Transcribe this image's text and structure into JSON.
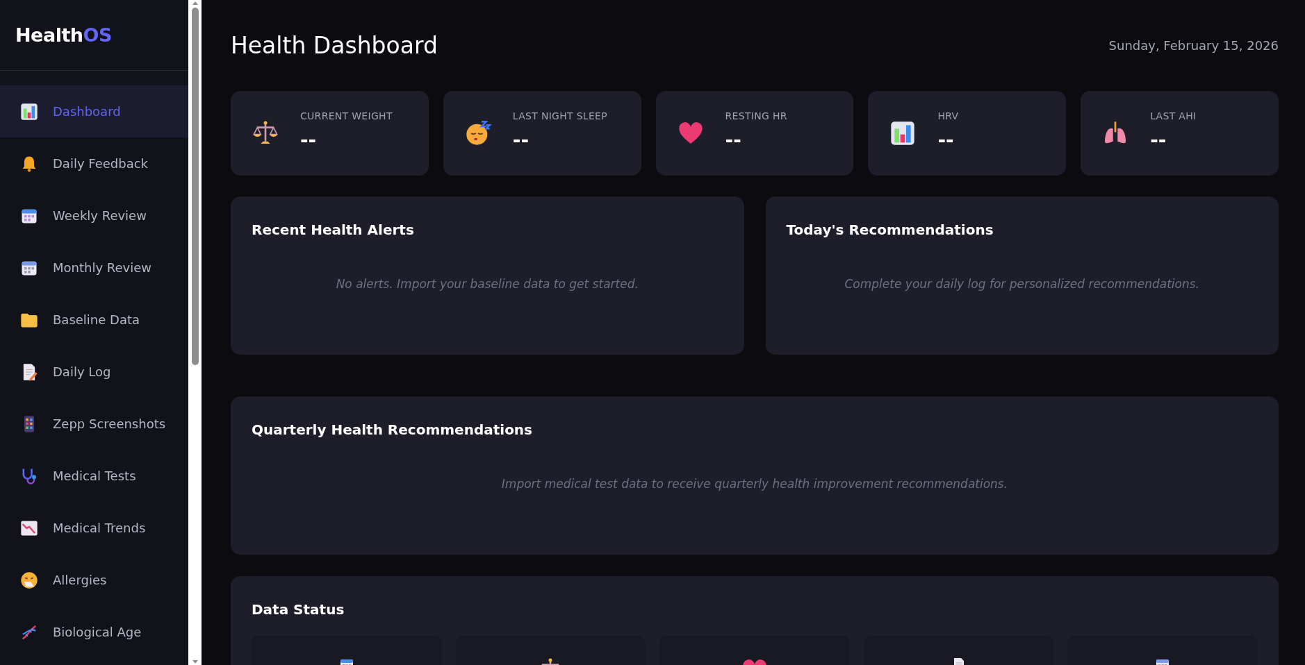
{
  "logo": {
    "prefix": "Health",
    "suffix": "OS"
  },
  "sidebar": {
    "items": [
      {
        "label": "Dashboard",
        "selected": true
      },
      {
        "label": "Daily Feedback",
        "selected": false
      },
      {
        "label": "Weekly Review",
        "selected": false
      },
      {
        "label": "Monthly Review",
        "selected": false
      },
      {
        "label": "Baseline Data",
        "selected": false
      },
      {
        "label": "Daily Log",
        "selected": false
      },
      {
        "label": "Zepp Screenshots",
        "selected": false
      },
      {
        "label": "Medical Tests",
        "selected": false
      },
      {
        "label": "Medical Trends",
        "selected": false
      },
      {
        "label": "Allergies",
        "selected": false
      },
      {
        "label": "Biological Age",
        "selected": false
      }
    ]
  },
  "header": {
    "title": "Health Dashboard",
    "date": "Sunday, February 15, 2026"
  },
  "stats": [
    {
      "label": "CURRENT WEIGHT",
      "value": "--"
    },
    {
      "label": "LAST NIGHT SLEEP",
      "value": "--"
    },
    {
      "label": "RESTING HR",
      "value": "--"
    },
    {
      "label": "HRV",
      "value": "--"
    },
    {
      "label": "LAST AHI",
      "value": "--"
    }
  ],
  "panels": [
    {
      "title": "Recent Health Alerts",
      "message": "No alerts. Import your baseline data to get started."
    },
    {
      "title": "Today's Recommendations",
      "message": "Complete your daily log for personalized recommendations."
    }
  ],
  "quarterly": {
    "title": "Quarterly Health Recommendations",
    "message": "Import medical test data to receive quarterly health improvement recommendations."
  },
  "data_status": {
    "title": "Data Status"
  }
}
